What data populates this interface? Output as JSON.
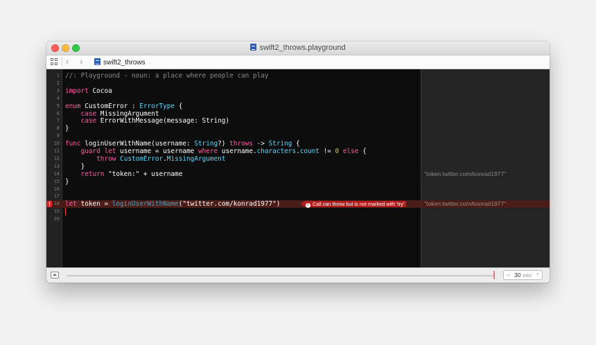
{
  "window": {
    "title": "swift2_throws.playground"
  },
  "jumpbar": {
    "back_icon": "chevron-left-icon",
    "forward_icon": "chevron-right-icon",
    "crumb": "swift2_throws"
  },
  "editor": {
    "lines": [
      {
        "n": "1",
        "tokens": [
          {
            "t": "//: Playground - noun: a place where people can play",
            "c": "comment"
          }
        ]
      },
      {
        "n": "2",
        "tokens": []
      },
      {
        "n": "3",
        "tokens": [
          {
            "t": "import",
            "c": "kw"
          },
          {
            "t": " Cocoa",
            "c": ""
          }
        ]
      },
      {
        "n": "4",
        "tokens": []
      },
      {
        "n": "5",
        "tokens": [
          {
            "t": "enum",
            "c": "kw"
          },
          {
            "t": " CustomError : ",
            "c": ""
          },
          {
            "t": "ErrorType",
            "c": "type"
          },
          {
            "t": " {",
            "c": ""
          }
        ]
      },
      {
        "n": "6",
        "tokens": [
          {
            "t": "    ",
            "c": ""
          },
          {
            "t": "case",
            "c": "kw"
          },
          {
            "t": " MissingArgument",
            "c": ""
          }
        ]
      },
      {
        "n": "7",
        "tokens": [
          {
            "t": "    ",
            "c": ""
          },
          {
            "t": "case",
            "c": "kw"
          },
          {
            "t": " ErrorWithMessage(message: String)",
            "c": ""
          }
        ]
      },
      {
        "n": "8",
        "tokens": [
          {
            "t": "}",
            "c": ""
          }
        ]
      },
      {
        "n": "9",
        "tokens": []
      },
      {
        "n": "10",
        "tokens": [
          {
            "t": "func",
            "c": "kw"
          },
          {
            "t": " loginUserWithName(username: ",
            "c": ""
          },
          {
            "t": "String",
            "c": "type"
          },
          {
            "t": "?) ",
            "c": ""
          },
          {
            "t": "throws",
            "c": "kw"
          },
          {
            "t": " -> ",
            "c": ""
          },
          {
            "t": "String",
            "c": "type"
          },
          {
            "t": " {",
            "c": ""
          }
        ]
      },
      {
        "n": "11",
        "tokens": [
          {
            "t": "    ",
            "c": ""
          },
          {
            "t": "guard",
            "c": "kw"
          },
          {
            "t": " ",
            "c": ""
          },
          {
            "t": "let",
            "c": "kw"
          },
          {
            "t": " username = username ",
            "c": ""
          },
          {
            "t": "where",
            "c": "kw"
          },
          {
            "t": " username.",
            "c": ""
          },
          {
            "t": "characters",
            "c": "type"
          },
          {
            "t": ".",
            "c": ""
          },
          {
            "t": "count",
            "c": "type"
          },
          {
            "t": " != ",
            "c": ""
          },
          {
            "t": "0",
            "c": "num"
          },
          {
            "t": " ",
            "c": ""
          },
          {
            "t": "else",
            "c": "kw"
          },
          {
            "t": " {",
            "c": ""
          }
        ]
      },
      {
        "n": "12",
        "tokens": [
          {
            "t": "        ",
            "c": ""
          },
          {
            "t": "throw",
            "c": "kw"
          },
          {
            "t": " ",
            "c": ""
          },
          {
            "t": "CustomError",
            "c": "type"
          },
          {
            "t": ".",
            "c": ""
          },
          {
            "t": "MissingArgument",
            "c": "type"
          }
        ]
      },
      {
        "n": "13",
        "tokens": [
          {
            "t": "    }",
            "c": ""
          }
        ]
      },
      {
        "n": "14",
        "tokens": [
          {
            "t": "    ",
            "c": ""
          },
          {
            "t": "return",
            "c": "kw"
          },
          {
            "t": " \"token:\" + username",
            "c": ""
          }
        ]
      },
      {
        "n": "15",
        "tokens": [
          {
            "t": "}",
            "c": ""
          }
        ]
      },
      {
        "n": "16",
        "tokens": []
      },
      {
        "n": "17",
        "tokens": []
      },
      {
        "n": "18",
        "error": true,
        "tokens": [
          {
            "t": "let",
            "c": "kw"
          },
          {
            "t": " token = ",
            "c": ""
          },
          {
            "t": "loginUserWithName",
            "c": "func"
          },
          {
            "t": "(\"twitter.com/konrad1977\")",
            "c": ""
          }
        ]
      },
      {
        "n": "19",
        "cursor": true,
        "tokens": []
      },
      {
        "n": "20",
        "tokens": []
      }
    ],
    "error_message": "Call can throw but is not marked with 'try'",
    "error_icon": "exclamation-circle-icon"
  },
  "results": [
    {
      "line": 14,
      "text": "\"token:twitter.com/konrad1977\""
    },
    {
      "line": 18,
      "text": "\"token:twitter.com/konrad1977\"",
      "error": true
    }
  ],
  "bottom": {
    "toggle_icon": "triangle-up-icon",
    "stepper_minus": "−",
    "stepper_value": "30",
    "stepper_unit": "sec",
    "stepper_plus": "+"
  }
}
